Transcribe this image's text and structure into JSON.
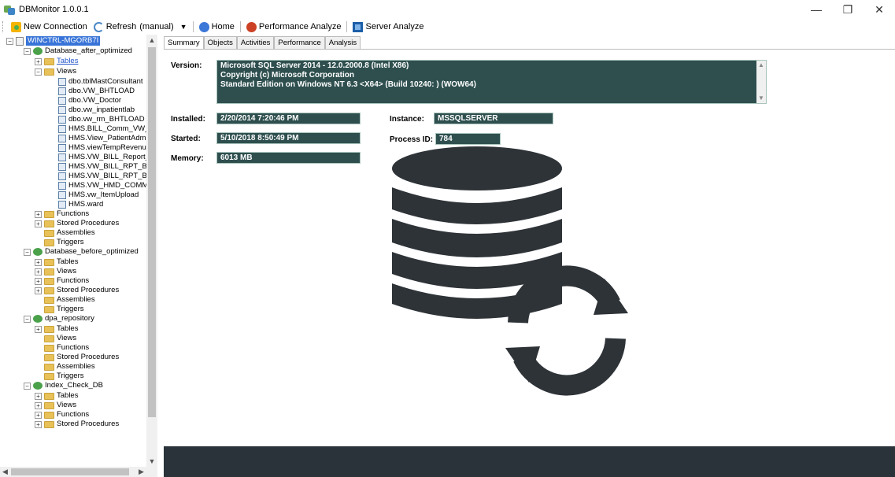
{
  "window": {
    "title": "DBMonitor 1.0.0.1",
    "minimize": "—",
    "restore": "❐",
    "close": "✕"
  },
  "toolbar": {
    "new_connection": "New Connection",
    "refresh": "Refresh",
    "refresh_mode": "(manual)",
    "home": "Home",
    "performance_analyze": "Performance Analyze",
    "server_analyze": "Server Analyze"
  },
  "tree": {
    "server": "WINCTRL-MGORB7I",
    "nodes": [
      {
        "label": "Database_after_optimized"
      },
      {
        "label": "Tables"
      },
      {
        "label": "Views"
      },
      {
        "label": "dbo.tblMastConsultant"
      },
      {
        "label": "dbo.VW_BHTLOAD"
      },
      {
        "label": "dbo.VW_Doctor"
      },
      {
        "label": "dbo.vw_inpatientlab"
      },
      {
        "label": "dbo.vw_rm_BHTLOAD"
      },
      {
        "label": "HMS.BILL_Comm_VW_"
      },
      {
        "label": "HMS.View_PatientAdmis"
      },
      {
        "label": "HMS.viewTempRevenu"
      },
      {
        "label": "HMS.VW_BILL_Report_"
      },
      {
        "label": "HMS.VW_BILL_RPT_B"
      },
      {
        "label": "HMS.VW_BILL_RPT_B"
      },
      {
        "label": "HMS.VW_HMD_COMM"
      },
      {
        "label": "HMS.vw_ItemUpload"
      },
      {
        "label": "HMS.ward"
      },
      {
        "label": "Functions"
      },
      {
        "label": "Stored Procedures"
      },
      {
        "label": "Assemblies"
      },
      {
        "label": "Triggers"
      },
      {
        "label": "Database_before_optimized"
      },
      {
        "label": "Tables"
      },
      {
        "label": "Views"
      },
      {
        "label": "Functions"
      },
      {
        "label": "Stored Procedures"
      },
      {
        "label": "Assemblies"
      },
      {
        "label": "Triggers"
      },
      {
        "label": "dpa_repository"
      },
      {
        "label": "Tables"
      },
      {
        "label": "Views"
      },
      {
        "label": "Functions"
      },
      {
        "label": "Stored Procedures"
      },
      {
        "label": "Assemblies"
      },
      {
        "label": "Triggers"
      },
      {
        "label": "Index_Check_DB"
      },
      {
        "label": "Tables"
      },
      {
        "label": "Views"
      },
      {
        "label": "Functions"
      },
      {
        "label": "Stored Procedures"
      }
    ]
  },
  "tabs": [
    "Summary",
    "Objects",
    "Activities",
    "Performance",
    "Analysis"
  ],
  "summary": {
    "version_label": "Version:",
    "version_lines": [
      "Microsoft SQL Server 2014 - 12.0.2000.8 (Intel X86)",
      "Copyright (c) Microsoft Corporation",
      "Standard Edition on Windows NT 6.3 <X64> (Build 10240: ) (WOW64)"
    ],
    "installed_label": "Installed:",
    "installed": "2/20/2014 7:20:46 PM",
    "started_label": "Started:",
    "started": "5/10/2018 8:50:49 PM",
    "memory_label": "Memory:",
    "memory": "6013 MB",
    "instance_label": "Instance:",
    "instance": "MSSQLSERVER",
    "process_label": "Process ID:",
    "process_id": "784"
  },
  "colors": {
    "field_bg": "#2f4f4f",
    "graphic": "#2e3338",
    "footer": "#2a333a",
    "selection": "#3874d8"
  }
}
